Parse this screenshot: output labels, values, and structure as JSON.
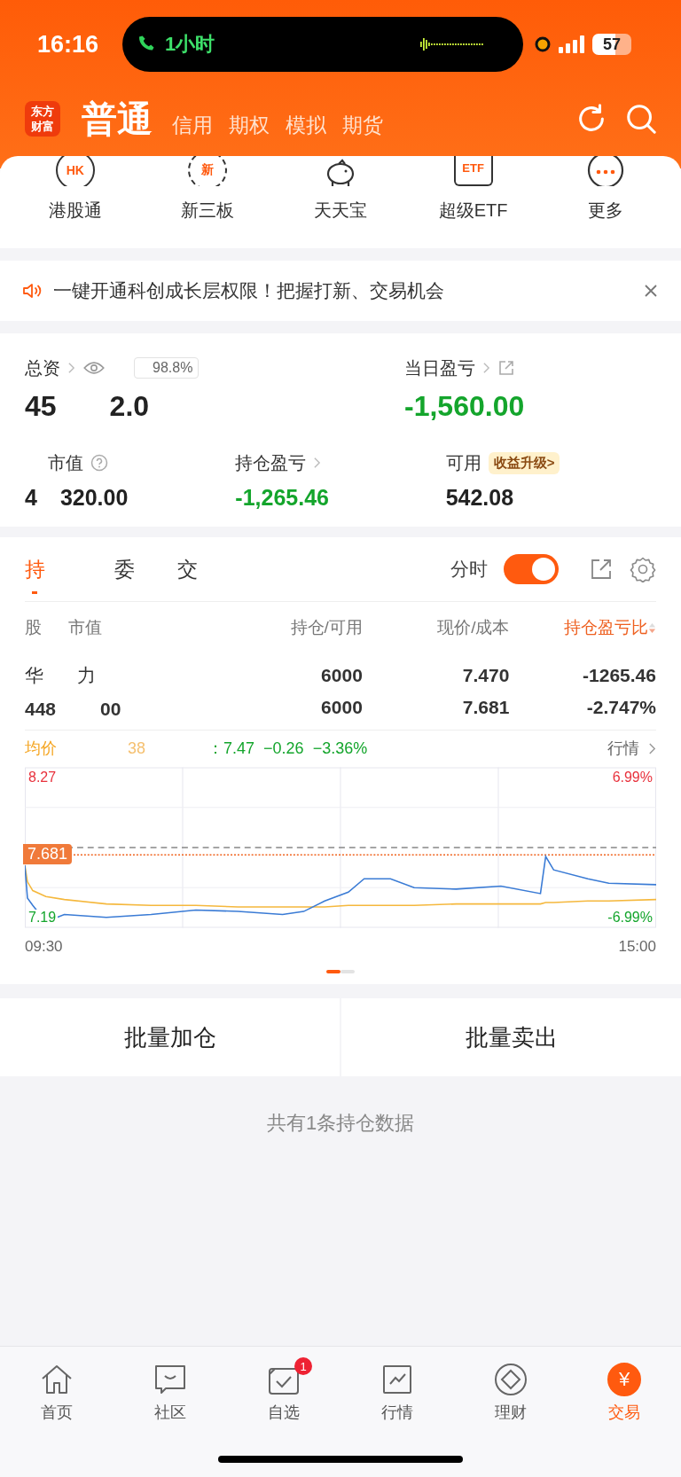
{
  "status_bar": {
    "time": "16:16",
    "call_duration": "1小时",
    "battery": "57"
  },
  "header": {
    "logo": "东方财富",
    "account_tabs": [
      {
        "label": "普通",
        "selected": true
      },
      {
        "label": "信用",
        "selected": false
      },
      {
        "label": "期权",
        "selected": false
      },
      {
        "label": "模拟",
        "selected": false
      },
      {
        "label": "期货",
        "selected": false
      }
    ]
  },
  "quick_entries": [
    {
      "label": "港股通",
      "kind": "ring",
      "icon_text": "HK"
    },
    {
      "label": "新三板",
      "kind": "cycle",
      "icon_text": "新"
    },
    {
      "label": "天天宝",
      "kind": "piggy"
    },
    {
      "label": "超级ETF",
      "kind": "basket",
      "icon_text": "ETF"
    },
    {
      "label": "更多",
      "kind": "dots"
    }
  ],
  "notice": {
    "text": "一键开通科创成长层权限！把握打新、交易机会"
  },
  "assets": {
    "total_label": "总资",
    "position_badge": "98.8%",
    "total_value_parts": [
      "45",
      "2.0"
    ],
    "daily_pnl_label": "当日盈亏",
    "daily_pnl": "-1,560.00",
    "market_value_label": "市值",
    "market_value_parts": [
      "4",
      "320.00"
    ],
    "holding_pnl_label": "持仓盈亏",
    "holding_pnl": "-1,265.46",
    "available_label": "可用",
    "available_tag": "收益升级>",
    "available": "542.08"
  },
  "positions": {
    "tabs": [
      {
        "label": "持",
        "selected": true
      },
      {
        "label": "委",
        "selected": false
      },
      {
        "label": "交",
        "selected": false
      }
    ],
    "toggle": {
      "label": "分时",
      "on": true
    },
    "columns": [
      {
        "label_parts": [
          "股",
          "市值"
        ],
        "sorted": false
      },
      {
        "label_parts": [
          "持仓/可用"
        ],
        "sorted": false
      },
      {
        "label_parts": [
          "现价/成本"
        ],
        "sorted": false
      },
      {
        "label_parts": [
          "持仓盈亏比"
        ],
        "sorted": true
      }
    ],
    "rows": [
      {
        "name_parts": [
          "华",
          "力"
        ],
        "value_parts": [
          "448",
          "00"
        ],
        "holding": "6000",
        "available": "6000",
        "price": "7.470",
        "cost": "7.681",
        "pnl": "-1265.46",
        "pnl_pct": "-2.747%"
      }
    ],
    "chart_legend": {
      "avg_label": "均价",
      "avg_value_part": "38",
      "price": "：7.47",
      "change": "−0.26",
      "change_pct": "−3.36%"
    },
    "chart_link": "行情",
    "chart_labels": {
      "high_price": "8.27",
      "low_price": "7.19",
      "high_percent": "6.99%",
      "low_percent": "-6.99%",
      "cost_tag": "7.681",
      "start_time": "09:30",
      "end_time": "15:00"
    },
    "pages": [
      {
        "selected": true
      },
      {
        "selected": false
      }
    ]
  },
  "actions": [
    "批量加仓",
    "批量卖出"
  ],
  "footer_note": "共有1条持仓数据",
  "tab_bar": [
    {
      "label": "首页",
      "kind": "home",
      "selected": false
    },
    {
      "label": "社区",
      "kind": "chat",
      "selected": false
    },
    {
      "label": "自选",
      "kind": "watch",
      "selected": false,
      "badge": "1"
    },
    {
      "label": "行情",
      "kind": "market",
      "selected": false
    },
    {
      "label": "理财",
      "kind": "wealth",
      "selected": false
    },
    {
      "label": "交易",
      "kind": "trade",
      "selected": true,
      "icon_text": "¥"
    }
  ]
}
